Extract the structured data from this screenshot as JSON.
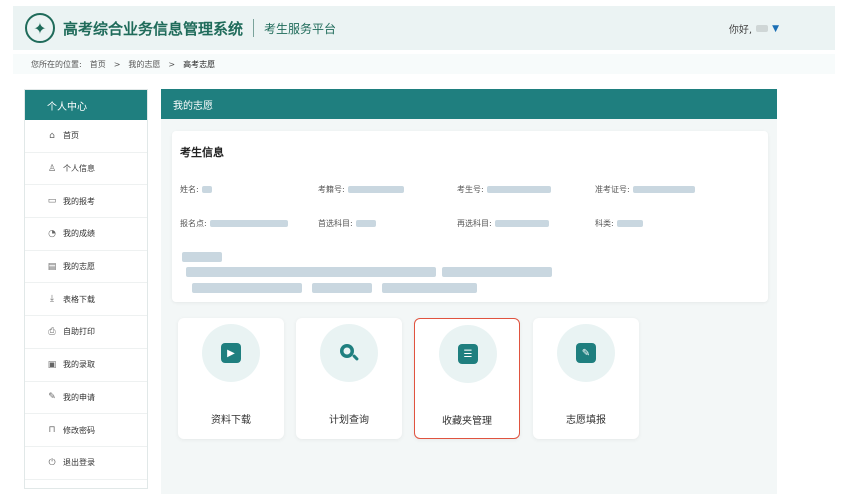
{
  "header": {
    "system_title": "高考综合业务信息管理系统",
    "platform_title": "考生服务平台",
    "greeting": "你好,",
    "logo_icon": "emblem-icon"
  },
  "breadcrumb": {
    "prefix": "您所在的位置:",
    "items": [
      "首页",
      "我的志愿",
      "高考志愿"
    ],
    "separator": ">"
  },
  "sidebar": {
    "title": "个人中心",
    "items": [
      {
        "label": "首页",
        "icon": "home-icon"
      },
      {
        "label": "个人信息",
        "icon": "person-icon"
      },
      {
        "label": "我的报考",
        "icon": "id-card-icon"
      },
      {
        "label": "我的成绩",
        "icon": "chart-icon"
      },
      {
        "label": "我的志愿",
        "icon": "document-icon"
      },
      {
        "label": "表格下载",
        "icon": "download-icon"
      },
      {
        "label": "自助打印",
        "icon": "print-icon"
      },
      {
        "label": "我的录取",
        "icon": "calendar-icon"
      },
      {
        "label": "我的申请",
        "icon": "edit-icon"
      },
      {
        "label": "修改密码",
        "icon": "lock-icon"
      },
      {
        "label": "退出登录",
        "icon": "logout-icon"
      }
    ]
  },
  "main": {
    "panel_title": "我的志愿",
    "info": {
      "title": "考生信息",
      "name_label": "姓名:",
      "exam_no_label": "考籍号:",
      "candidate_no_label": "考生号:",
      "ticket_no_label": "准考证号:",
      "site_label": "报名点:",
      "first_subject_label": "首选科目:",
      "second_subject_label": "再选科目:",
      "category_label": "科类:"
    },
    "tiles": [
      {
        "label": "资料下载",
        "icon": "play-icon"
      },
      {
        "label": "计划查询",
        "icon": "search-icon"
      },
      {
        "label": "收藏夹管理",
        "icon": "list-icon"
      },
      {
        "label": "志愿填报",
        "icon": "form-edit-icon"
      }
    ]
  },
  "colors": {
    "primary": "#1f7f7f",
    "header_bg": "#ebf3f3",
    "highlight_border": "#e0533f"
  }
}
